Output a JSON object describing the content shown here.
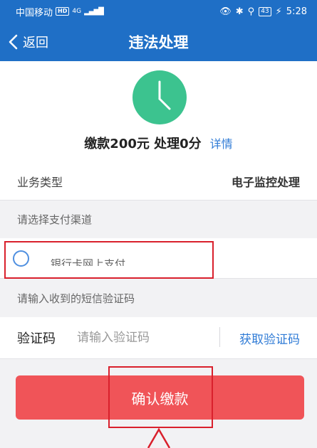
{
  "status_bar": {
    "carrier": "中国移动",
    "hd": "HD",
    "network": "4G",
    "battery": "43",
    "time": "5:28"
  },
  "nav": {
    "back_label": "返回",
    "title": "违法处理"
  },
  "summary": {
    "text": "缴款200元 处理0分",
    "detail_link": "详情"
  },
  "business": {
    "label": "业务类型",
    "value": "电子监控处理"
  },
  "payment": {
    "section_hint": "请选择支付渠道",
    "option_text": "银行卡网上支付"
  },
  "sms": {
    "section_hint": "请输入收到的短信验证码",
    "code_label": "验证码",
    "code_placeholder": "请输入验证码",
    "code_value": "",
    "get_code_label": "获取验证码"
  },
  "confirm_label": "确认缴款",
  "colors": {
    "primary_blue": "#1f6fc6",
    "accent_green": "#3cc38f",
    "confirm_red": "#f05458",
    "annotation_red": "#d9202c",
    "link_blue": "#2f7bd6"
  }
}
